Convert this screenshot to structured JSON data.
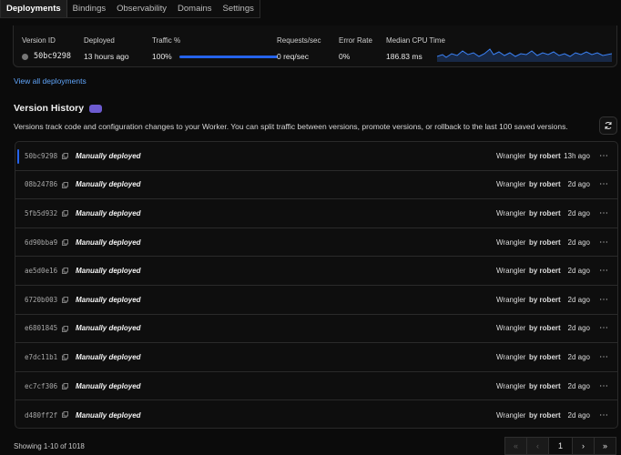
{
  "tabs": [
    "Deployments",
    "Bindings",
    "Observability",
    "Domains",
    "Settings"
  ],
  "summary": {
    "headers": {
      "version_id": "Version ID",
      "deployed": "Deployed",
      "traffic": "Traffic %",
      "requests": "Requests/sec",
      "error_rate": "Error Rate",
      "cpu": "Median CPU Time"
    },
    "values": {
      "version_id": "50bc9298",
      "deployed": "13 hours ago",
      "traffic": "100%",
      "requests": "0 req/sec",
      "error_rate": "0%",
      "cpu": "186.83 ms"
    },
    "traffic_fraction": 1.0,
    "accent": "#2563eb"
  },
  "view_all": "View all deployments",
  "version_history": {
    "title": "Version History",
    "description": "Versions track code and configuration changes to your Worker. You can split traffic between versions, promote versions, or rollback to the last 100 saved versions.",
    "badge_color": "#6d5bd0"
  },
  "rows": [
    {
      "id": "50bc9298",
      "message": "Manually deployed",
      "source": "Wrangler",
      "by": "by robert",
      "ago": "13h ago"
    },
    {
      "id": "08b24786",
      "message": "Manually deployed",
      "source": "Wrangler",
      "by": "by robert",
      "ago": "2d ago"
    },
    {
      "id": "5fb5d932",
      "message": "Manually deployed",
      "source": "Wrangler",
      "by": "by robert",
      "ago": "2d ago"
    },
    {
      "id": "6d90bba9",
      "message": "Manually deployed",
      "source": "Wrangler",
      "by": "by robert",
      "ago": "2d ago"
    },
    {
      "id": "ae5d0e16",
      "message": "Manually deployed",
      "source": "Wrangler",
      "by": "by robert",
      "ago": "2d ago"
    },
    {
      "id": "6720b003",
      "message": "Manually deployed",
      "source": "Wrangler",
      "by": "by robert",
      "ago": "2d ago"
    },
    {
      "id": "e6801845",
      "message": "Manually deployed",
      "source": "Wrangler",
      "by": "by robert",
      "ago": "2d ago"
    },
    {
      "id": "e7dc11b1",
      "message": "Manually deployed",
      "source": "Wrangler",
      "by": "by robert",
      "ago": "2d ago"
    },
    {
      "id": "ec7cf306",
      "message": "Manually deployed",
      "source": "Wrangler",
      "by": "by robert",
      "ago": "2d ago"
    },
    {
      "id": "d480ff2f",
      "message": "Manually deployed",
      "source": "Wrangler",
      "by": "by robert",
      "ago": "2d ago"
    }
  ],
  "more_label": "⋯",
  "footer": {
    "showing": "Showing 1-10 of 1018",
    "page": "1",
    "first": "«",
    "prev": "‹",
    "next": "›",
    "last": "»"
  }
}
